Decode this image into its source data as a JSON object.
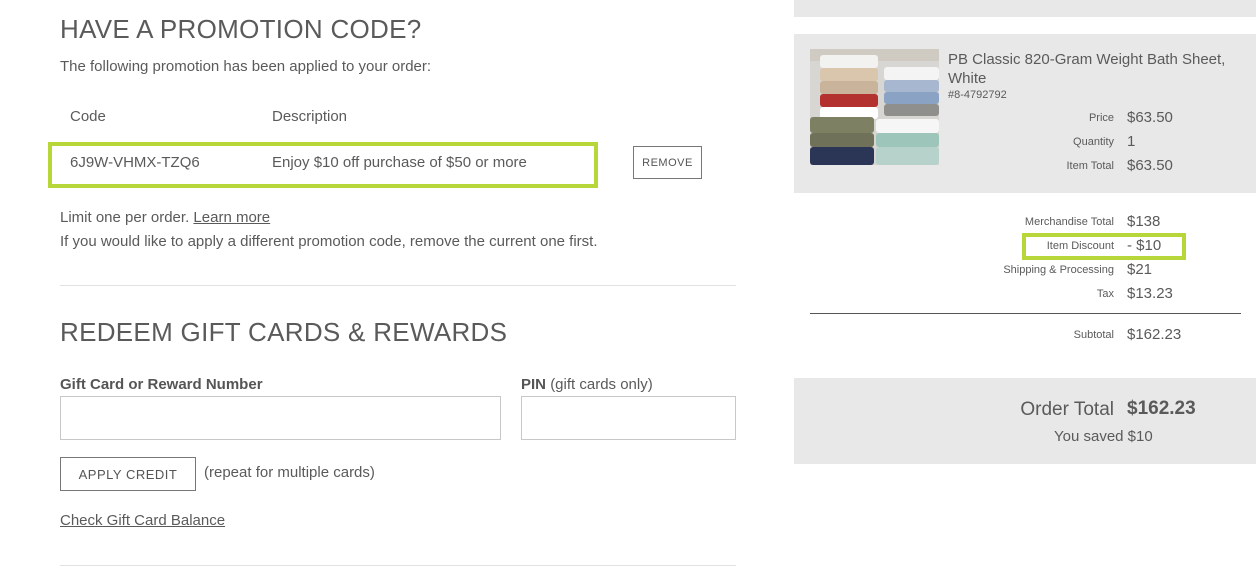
{
  "promo": {
    "heading": "HAVE A PROMOTION CODE?",
    "applied_text": "The following promotion has been applied to your order:",
    "col_code": "Code",
    "col_description": "Description",
    "code": "6J9W-VHMX-TZQ6",
    "description": "Enjoy $10 off purchase of $50 or more",
    "remove_label": "REMOVE",
    "limit_text": "Limit one per order.",
    "learn_more": "Learn more",
    "note": "If you would like to apply a different promotion code, remove the current one first."
  },
  "gift": {
    "heading": "REDEEM GIFT CARDS & REWARDS",
    "card_label": "Gift Card or Reward Number",
    "card_value": "",
    "pin_label": "PIN",
    "pin_sublabel": "(gift cards only)",
    "pin_value": "",
    "apply_label": "APPLY CREDIT",
    "repeat_note": "(repeat for multiple cards)",
    "balance_link": "Check Gift Card Balance"
  },
  "summary": {
    "item": {
      "name": "PB Classic 820-Gram Weight Bath Sheet, White",
      "sku": "#8-4792792",
      "price_label": "Price",
      "price": "$63.50",
      "qty_label": "Quantity",
      "qty": "1",
      "total_label": "Item Total",
      "total": "$63.50",
      "image_alt": "stacked bath towels"
    },
    "merch_label": "Merchandise Total",
    "merch": "$138",
    "discount_label": "Item Discount",
    "discount": "- $10",
    "shipping_label": "Shipping & Processing",
    "shipping": "$21",
    "tax_label": "Tax",
    "tax": "$13.23",
    "subtotal_label": "Subtotal",
    "subtotal": "$162.23",
    "order_total_label": "Order Total",
    "order_total": "$162.23",
    "saved_text": "You saved $10"
  },
  "colors": {
    "highlight": "#b7d63a",
    "panel": "#e8e8e8",
    "text": "#5a5a5a"
  }
}
